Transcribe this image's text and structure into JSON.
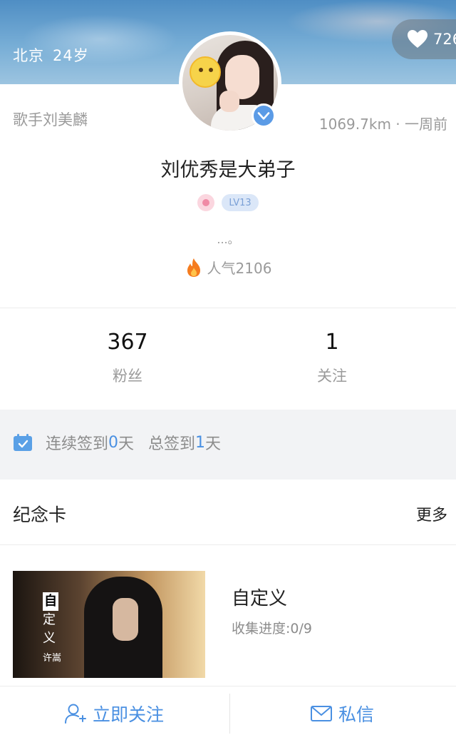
{
  "header": {
    "location": "北京",
    "age": "24岁",
    "likes": "726"
  },
  "profile": {
    "title_tag": "歌手刘美麟",
    "distance_time": "1069.7km · 一周前",
    "nickname": "刘优秀是大弟子",
    "level": "LV13",
    "bio": "...。",
    "popularity": "人气2106"
  },
  "stats": {
    "fans_count": "367",
    "fans_label": "粉丝",
    "following_count": "1",
    "following_label": "关注"
  },
  "checkin": {
    "prefix": "连续签到",
    "streak": "0",
    "unit1": "天",
    "total_prefix": "总签到",
    "total": "1",
    "unit2": "天"
  },
  "section": {
    "title": "纪念卡",
    "more": "更多"
  },
  "card": {
    "name": "自定义",
    "progress": "收集进度:0/9",
    "image_text": [
      "自",
      "定",
      "义",
      "许嵩"
    ]
  },
  "bottom": {
    "follow": "立即关注",
    "message": "私信"
  },
  "colors": {
    "accent": "#4a90e2",
    "muted": "#9a9a9a",
    "verified": "#5b9be6"
  }
}
